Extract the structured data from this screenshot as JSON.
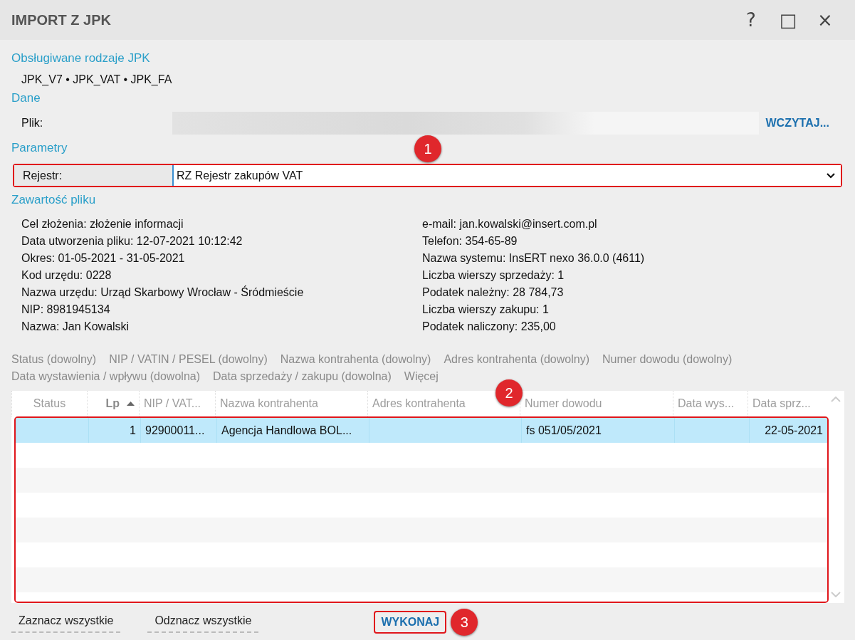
{
  "window": {
    "title": "IMPORT Z JPK",
    "controls": [
      "?",
      "□",
      "×"
    ]
  },
  "supported": {
    "heading": "Obsługiwane rodzaje JPK",
    "value": "JPK_V7 • JPK_VAT • JPK_FA"
  },
  "data": {
    "heading": "Dane",
    "file_label": "Plik:",
    "load_button": "WCZYTAJ..."
  },
  "parameters": {
    "heading": "Parametry",
    "register_label": "Rejestr:",
    "register_value": "RZ  Rejestr zakupów VAT",
    "highlighted": true,
    "callout": "1"
  },
  "contents": {
    "heading": "Zawartość pliku",
    "left": [
      "Cel złożenia: złożenie informacji",
      "Data utworzenia pliku: 12-07-2021 10:12:42",
      "Okres: 01-05-2021 - 31-05-2021",
      "Kod urzędu: 0228",
      "Nazwa urzędu: Urząd Skarbowy Wrocław - Śródmieście",
      "NIP: 8981945134",
      "Nazwa: Jan Kowalski"
    ],
    "right": [
      "e-mail: jan.kowalski@insert.com.pl",
      "Telefon: 354-65-89",
      "Nazwa systemu: InsERT nexo 36.0.0 (4611)",
      "Liczba wierszy sprzedaży: 1",
      "Podatek należny: 28 784,73",
      "Liczba wierszy zakupu: 1",
      "Podatek naliczony: 235,00"
    ]
  },
  "filters": [
    "Status (dowolny)",
    "NIP / VATIN / PESEL (dowolny)",
    "Nazwa kontrahenta (dowolny)",
    "Adres kontrahenta (dowolny)",
    "Numer dowodu (dowolny)",
    "Data wystawienia / wpływu (dowolna)",
    "Data sprzedaży / zakupu (dowolna)",
    "Więcej"
  ],
  "table": {
    "highlighted": true,
    "callout": "2",
    "columns": [
      {
        "label": "Status",
        "sorted": false
      },
      {
        "label": "Lp",
        "sorted": true
      },
      {
        "label": "NIP / VAT...",
        "sorted": false
      },
      {
        "label": "Nazwa kontrahenta",
        "sorted": false
      },
      {
        "label": "Adres kontrahenta",
        "sorted": false
      },
      {
        "label": "Numer dowodu",
        "sorted": false
      },
      {
        "label": "Data wys...",
        "sorted": false
      },
      {
        "label": "Data sprz...",
        "sorted": false
      }
    ],
    "rows": [
      {
        "selected": true,
        "cells": [
          "",
          "1",
          "92900011...",
          "Agencja Handlowa BOL...",
          "",
          "fs 051/05/2021",
          "",
          "22-05-2021"
        ]
      }
    ]
  },
  "footer": {
    "select_all": "Zaznacz wszystkie",
    "deselect_all": "Odznacz wszystkie",
    "execute": "WYKONAJ",
    "execute_highlighted": true,
    "callout": "3"
  }
}
